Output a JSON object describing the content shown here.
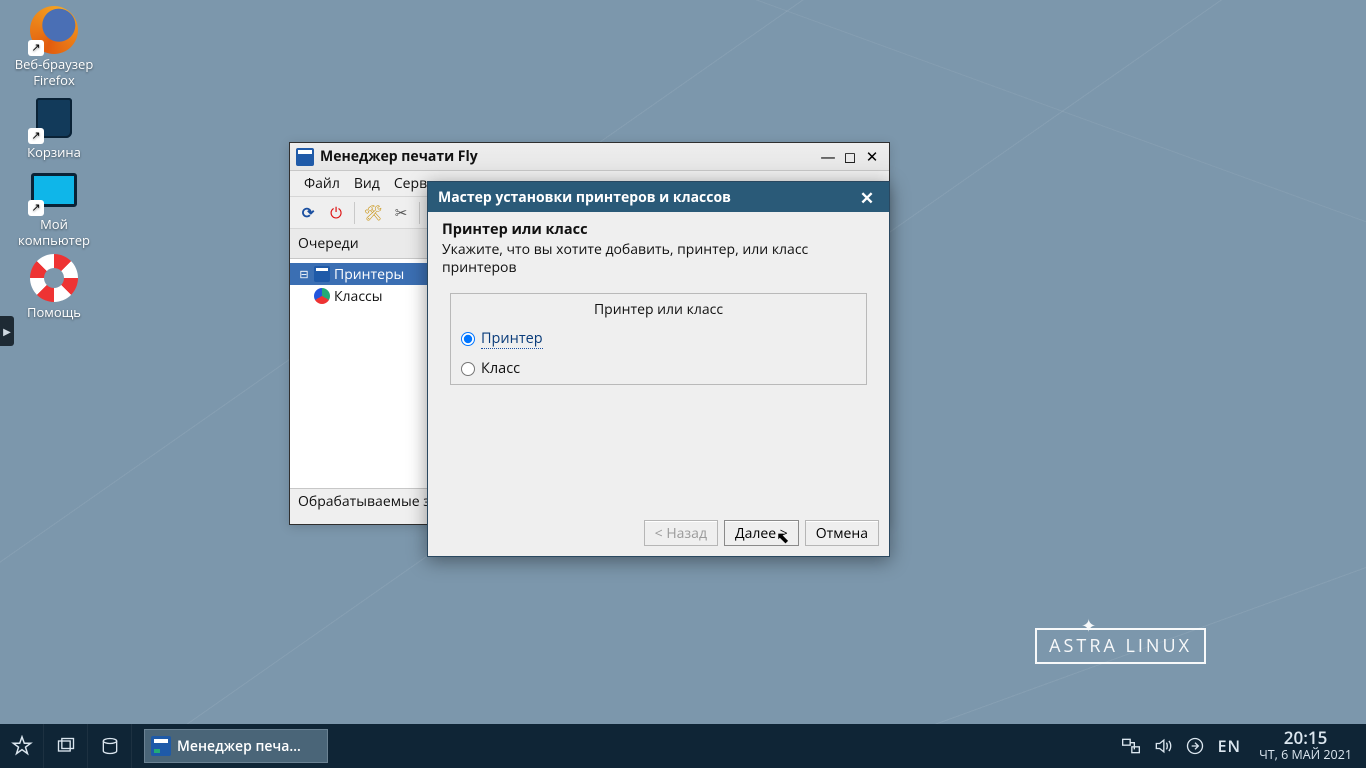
{
  "desktop": {
    "icons": [
      {
        "name": "firefox",
        "label_line1": "Веб-браузер",
        "label_line2": "Firefox"
      },
      {
        "name": "trash",
        "label_line1": "Корзина",
        "label_line2": ""
      },
      {
        "name": "computer",
        "label_line1": "Мой",
        "label_line2": "компьютер"
      },
      {
        "name": "help",
        "label_line1": "Помощь",
        "label_line2": ""
      }
    ]
  },
  "watermark": {
    "text": "ASTRA LINUX"
  },
  "main_window": {
    "title": "Менеджер печати Fly",
    "menu": [
      "Файл",
      "Вид",
      "Серв…"
    ],
    "sidebar_header": "Очереди",
    "tree": {
      "printers": "Принтеры",
      "classes": "Классы"
    },
    "status": "Обрабатываемые з"
  },
  "dialog": {
    "title": "Мастер установки принтеров и классов",
    "heading": "Принтер или класс",
    "subheading": "Укажите, что вы хотите добавить, принтер, или класс принтеров",
    "group_title": "Принтер или класс",
    "opt_printer": "Принтер",
    "opt_class": "Класс",
    "btn_back": "< Назад",
    "btn_next": "Далее >",
    "btn_cancel": "Отмена"
  },
  "taskbar": {
    "task_label": "Менеджер печа…",
    "lang": "EN",
    "time": "20:15",
    "date": "ЧТ, 6 МАЙ 2021"
  }
}
